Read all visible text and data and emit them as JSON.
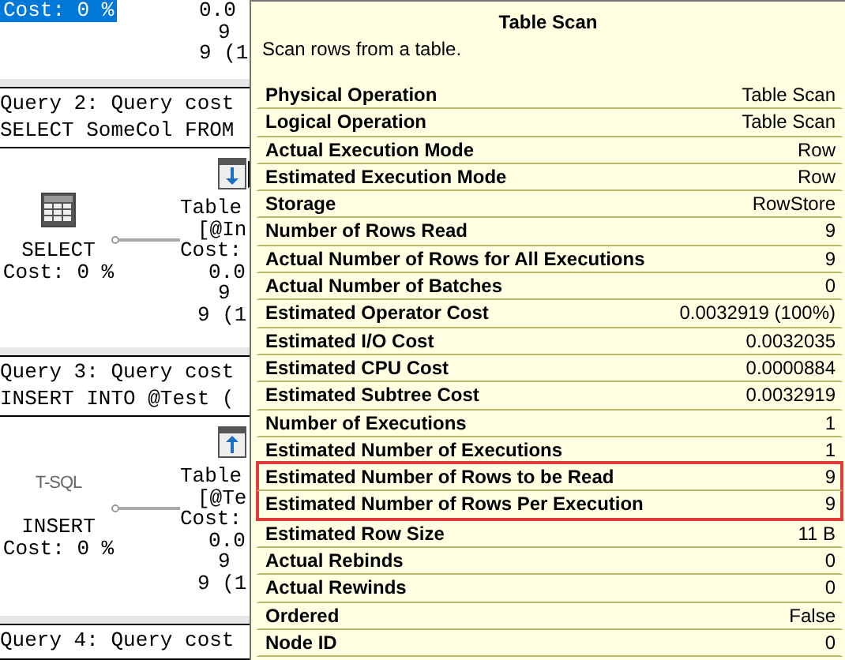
{
  "plan": {
    "top_node": {
      "cost": "Cost: 0 %",
      "selected": true,
      "lines": [
        "0.0",
        "9",
        "9 (1"
      ]
    },
    "queries": [
      {
        "header": "Query 2: Query cost",
        "sql": "SELECT SomeCol FROM",
        "root": {
          "kind": "select",
          "label": "SELECT",
          "cost": "Cost: 0 %"
        },
        "operator": {
          "kind": "scan",
          "lines": [
            "Table",
            "[@In",
            "Cost:",
            "0.0",
            "9",
            "9 (1"
          ]
        }
      },
      {
        "header": "Query 3: Query cost",
        "sql": "INSERT INTO @Test (",
        "root": {
          "kind": "tsql",
          "icon_text": "T-SQL",
          "label": "INSERT",
          "cost": "Cost: 0 %"
        },
        "operator": {
          "kind": "insert",
          "lines": [
            "Table",
            "[@Te",
            "Cost:",
            "0.0",
            "9",
            "9 (1"
          ]
        }
      },
      {
        "header": "Query 4: Query cost"
      }
    ]
  },
  "tooltip": {
    "title": "Table Scan",
    "description": "Scan rows from a table.",
    "rows": [
      {
        "name": "Physical Operation",
        "value": "Table Scan",
        "highlighted": false
      },
      {
        "name": "Logical Operation",
        "value": "Table Scan",
        "highlighted": false
      },
      {
        "name": "Actual Execution Mode",
        "value": "Row",
        "highlighted": false
      },
      {
        "name": "Estimated Execution Mode",
        "value": "Row",
        "highlighted": false
      },
      {
        "name": "Storage",
        "value": "RowStore",
        "highlighted": false
      },
      {
        "name": "Number of Rows Read",
        "value": "9",
        "highlighted": false
      },
      {
        "name": "Actual Number of Rows for All Executions",
        "value": "9",
        "highlighted": false
      },
      {
        "name": "Actual Number of Batches",
        "value": "0",
        "highlighted": false
      },
      {
        "name": "Estimated Operator Cost",
        "value": "0.0032919 (100%)",
        "highlighted": false
      },
      {
        "name": "Estimated I/O Cost",
        "value": "0.0032035",
        "highlighted": false
      },
      {
        "name": "Estimated CPU Cost",
        "value": "0.0000884",
        "highlighted": false
      },
      {
        "name": "Estimated Subtree Cost",
        "value": "0.0032919",
        "highlighted": false
      },
      {
        "name": "Number of Executions",
        "value": "1",
        "highlighted": false
      },
      {
        "name": "Estimated Number of Executions",
        "value": "1",
        "highlighted": false
      },
      {
        "name": "Estimated Number of Rows to be Read",
        "value": "9",
        "highlighted": true
      },
      {
        "name": "Estimated Number of Rows Per Execution",
        "value": "9",
        "highlighted": true
      },
      {
        "name": "Estimated Row Size",
        "value": "11 B",
        "highlighted": false
      },
      {
        "name": "Actual Rebinds",
        "value": "0",
        "highlighted": false
      },
      {
        "name": "Actual Rewinds",
        "value": "0",
        "highlighted": false
      },
      {
        "name": "Ordered",
        "value": "False",
        "highlighted": false
      },
      {
        "name": "Node ID",
        "value": "0",
        "highlighted": false
      }
    ]
  }
}
